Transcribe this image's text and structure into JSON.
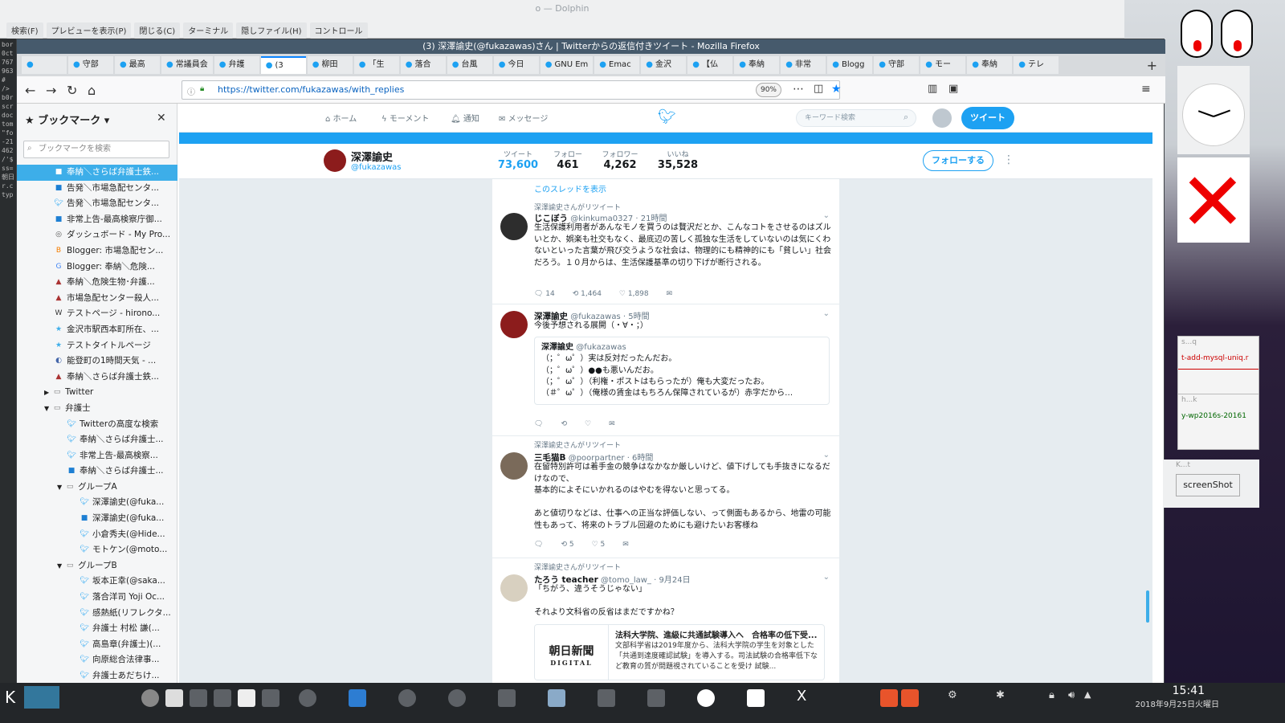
{
  "dolphin": {
    "title": "o — Dolphin",
    "toolbar": [
      "検索(F)",
      "プレビューを表示(P)",
      "閉じる(C)",
      "ターミナル",
      "隠しファイル(H)",
      "コントロール"
    ]
  },
  "terminal_fragment": "bor\n0ct\n767\n963\n#\n/>\nb0r\nscr\ndoc\ntom\n\"fo\n-21\n462\n/'$\nss=\n朝日\nr.c\ntyp",
  "firefox": {
    "title": "(3) 深澤諭史(@fukazawas)さん | Twitterからの返信付きツイート - Mozilla Firefox",
    "tabs": [
      "",
      "守部",
      "最高",
      "常議員会",
      "弁護",
      "(3",
      "柳田",
      "「生",
      "落合",
      "台風",
      "今日",
      "GNU Em",
      "Emac",
      "金沢",
      "【仏",
      "奉納",
      "非常",
      "Blogg",
      "守部",
      "モー",
      "奉納",
      "テレ"
    ],
    "url": "https://twitter.com/fukazawas/with_replies",
    "zoom": "90%"
  },
  "bookmarks": {
    "title": "ブックマーク",
    "search_placeholder": "ブックマークを検索",
    "items": [
      {
        "label": "奉納＼さらば弁護士鉄...",
        "icon": "b",
        "depth": 0
      },
      {
        "label": "告発＼市場急配センタ...",
        "icon": "b",
        "depth": 0
      },
      {
        "label": "告発＼市場急配センタ...",
        "icon": "t",
        "depth": 0
      },
      {
        "label": "非常上告-最高検察庁御...",
        "icon": "b",
        "depth": 0
      },
      {
        "label": "ダッシュボード - My Pro...",
        "icon": "g",
        "depth": 0
      },
      {
        "label": "Blogger: 市場急配セン...",
        "icon": "o",
        "depth": 0
      },
      {
        "label": "Blogger: 奉納＼危険...",
        "icon": "G",
        "depth": 0
      },
      {
        "label": "奉納＼危険生物･弁護...",
        "icon": "h",
        "depth": 0
      },
      {
        "label": "市場急配センター殺人...",
        "icon": "h",
        "depth": 0
      },
      {
        "label": "テストページ - hirono...",
        "icon": "W",
        "depth": 0
      },
      {
        "label": "金沢市駅西本町所在、...",
        "icon": "s",
        "depth": 0
      },
      {
        "label": "テストタイトルページ",
        "icon": "s",
        "depth": 0
      },
      {
        "label": "能登町の1時間天気 - ...",
        "icon": "w",
        "depth": 0
      },
      {
        "label": "奉納＼さらば弁護士鉄...",
        "icon": "h",
        "depth": 0
      },
      {
        "label": "Twitter",
        "icon": "folder",
        "depth": 0,
        "toggle": "▶"
      },
      {
        "label": "弁護士",
        "icon": "folder",
        "depth": 0,
        "toggle": "▼"
      },
      {
        "label": "Twitterの高度な検索",
        "icon": "t",
        "depth": 1
      },
      {
        "label": "奉納＼さらば弁護士...",
        "icon": "t",
        "depth": 1
      },
      {
        "label": "非常上告-最高検察...",
        "icon": "t",
        "depth": 1
      },
      {
        "label": "奉納＼さらば弁護士...",
        "icon": "b",
        "depth": 1
      },
      {
        "label": "グループA",
        "icon": "folder",
        "depth": 1,
        "toggle": "▼"
      },
      {
        "label": "深澤諭史(@fuka...",
        "icon": "t",
        "depth": 2
      },
      {
        "label": "深澤諭史(@fuka...",
        "icon": "b",
        "depth": 2
      },
      {
        "label": "小倉秀夫(@Hide...",
        "icon": "t",
        "depth": 2
      },
      {
        "label": "モトケン(@moto...",
        "icon": "t",
        "depth": 2
      },
      {
        "label": "グループB",
        "icon": "folder",
        "depth": 1,
        "toggle": "▼"
      },
      {
        "label": "坂本正幸(@saka...",
        "icon": "t",
        "depth": 2
      },
      {
        "label": "落合洋司 Yoji Oc...",
        "icon": "t",
        "depth": 2
      },
      {
        "label": "感熱紙(リフレクタ...",
        "icon": "t",
        "depth": 2
      },
      {
        "label": "弁護士 村松 謙(...",
        "icon": "t",
        "depth": 2
      },
      {
        "label": "高島章(弁護士)(...",
        "icon": "t",
        "depth": 2
      },
      {
        "label": "向原総合法律事...",
        "icon": "t",
        "depth": 2
      },
      {
        "label": "弁護士あだちけ...",
        "icon": "t",
        "depth": 2
      }
    ]
  },
  "twitter": {
    "nav": [
      "ホーム",
      "モーメント",
      "通知",
      "メッセージ"
    ],
    "search_placeholder": "キーワード検索",
    "tweet_button": "ツイート",
    "profile": {
      "name": "深澤諭史",
      "handle": "@fukazawas",
      "stats": [
        {
          "label": "ツイート",
          "value": "73,600"
        },
        {
          "label": "フォロー",
          "value": "461"
        },
        {
          "label": "フォロワー",
          "value": "4,262"
        },
        {
          "label": "いいね",
          "value": "35,528"
        }
      ],
      "follow_button": "フォローする"
    },
    "thread_link": "このスレッドを表示",
    "tweets": [
      {
        "retweet_label": "深澤諭史さんがリツイート",
        "name": "じこぼう",
        "handle": "@kinkuma0327",
        "time": "· 21時間",
        "text": "生活保護利用者があんなモノを買うのは贅沢だとか、こんなコトをさせるのはズルいとか、娯楽も社交もなく、最底辺の苦しく孤独な生活をしていないのは気にくわないといった言葉が飛び交うような社会は、物理的にも精神的にも「貧しい」社会だろう。１０月からは、生活保護基準の切り下げが断行される。",
        "replies": "14",
        "retweets": "1,464",
        "likes": "1,898"
      },
      {
        "retweet_label": "",
        "name": "深澤諭史",
        "handle": "@fukazawas",
        "time": "· 5時間",
        "text": "今後予想される展開（・∀・；）",
        "quote_name": "深澤諭史",
        "quote_handle": "@fukazawas",
        "quote_text": "（；゜ω゜）実は反対だったんだお。\n（；゜ω゜）●●も悪いんだお。\n（；゜ω゜）（利権・ポストはもらったが）俺も大変だったお。\n（＃゜ω゜）（俺様の賃金はもちろん保障されているが）赤字だから…",
        "replies": "",
        "retweets": "",
        "likes": ""
      },
      {
        "retweet_label": "深澤諭史さんがリツイート",
        "name": "三毛猫B",
        "handle": "@poorpartner",
        "time": "· 6時間",
        "text": "在留特別許可は着手金の競争はなかなか厳しいけど、値下げしても手抜きになるだけなので、\n基本的によそにいかれるのはやむを得ないと思ってる。\n\nあと値切りなどは、仕事への正当な評価しない、って側面もあるから、地雷の可能性もあって、将来のトラブル回避のためにも避けたいお客様ね",
        "replies": "",
        "retweets": "5",
        "likes": "5"
      },
      {
        "retweet_label": "深澤諭史さんがリツイート",
        "name": "たろう teacher",
        "handle": "@tomo_law_",
        "time": "· 9月24日",
        "text": "「ちがう、違うそうじゃない」\n\nそれより文科省の反省はまだですかね？",
        "card_logo": "朝日新聞",
        "card_logo_sub": "DIGITAL",
        "card_title": "法科大学院、進級に共通試験導入へ　合格率の低下受...",
        "card_desc": "文部科学省は2019年度から、法科大学院の学生を対象とした「共通到達度確認試験」を導入する。司法試験の合格率低下など教育の質が問題視されていることを受け 試験..."
      }
    ]
  },
  "right_panel": {
    "win1": "s...q",
    "win1_text": "t-add-mysql-uniq.r",
    "win2": "h...k",
    "win2_text": "y-wp2016s-20161",
    "win3": "K...t",
    "screenshot_button": "screenShot"
  },
  "taskbar": {
    "time": "15:41",
    "date": "2018年9月25日火曜日"
  }
}
